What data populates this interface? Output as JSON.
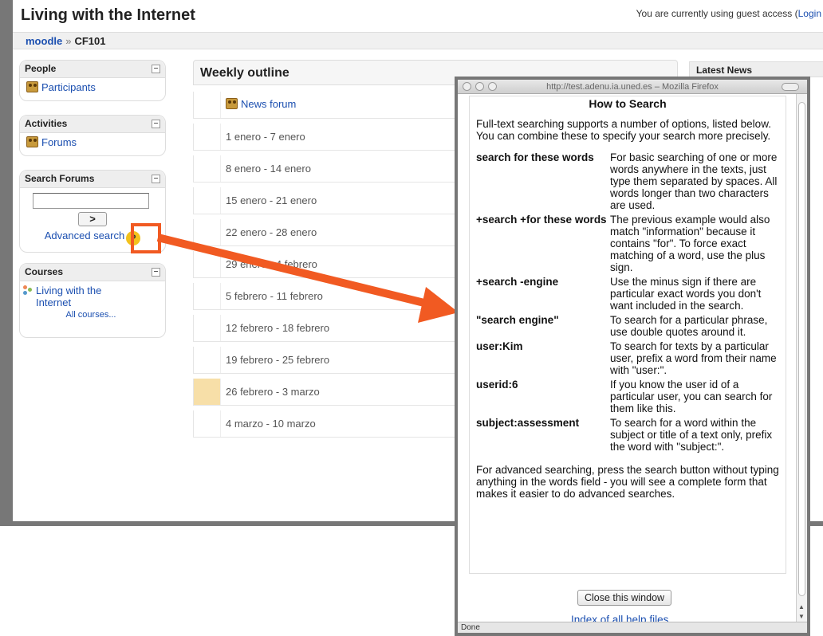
{
  "site": {
    "title": "Living with the Internet",
    "login_text": "You are currently using guest access (",
    "login_link": "Login"
  },
  "breadcrumb": {
    "home": "moodle",
    "sep": "»",
    "course": "CF101"
  },
  "blocks": {
    "people": {
      "title": "People",
      "toggle": "–",
      "item": "Participants"
    },
    "activities": {
      "title": "Activities",
      "toggle": "–",
      "item": "Forums"
    },
    "search": {
      "title": "Search Forums",
      "toggle": "–",
      "go": ">",
      "advanced": "Advanced search",
      "help": "?"
    },
    "courses": {
      "title": "Courses",
      "toggle": "–",
      "item": "Living with the Internet",
      "all": "All courses..."
    }
  },
  "outline": {
    "title": "Weekly outline",
    "news": "News forum",
    "weeks": [
      "1 enero - 7 enero",
      "8 enero - 14 enero",
      "15 enero - 21 enero",
      "22 enero - 28 enero",
      "29 enero - 4 febrero",
      "5 febrero - 11 febrero",
      "12 febrero - 18 febrero",
      "19 febrero - 25 febrero",
      "26 febrero - 3 marzo",
      "4 marzo - 10 marzo"
    ]
  },
  "right_block": {
    "title": "Latest News",
    "toggle": "–"
  },
  "popup": {
    "url": "http://test.adenu.ia.uned.es – Mozilla Firefox",
    "heading": "How to Search",
    "intro": "Full-text searching supports a number of options, listed below. You can combine these to specify your search more precisely.",
    "rows": [
      {
        "key": "search for these words",
        "desc": "For basic searching of one or more words anywhere in the texts, just type them separated by spaces. All words longer than two characters are used."
      },
      {
        "key": "+search +for these words",
        "desc": "The previous example would also match \"information\" because it contains \"for\". To force exact matching of a word, use the plus sign."
      },
      {
        "key": "+search -engine",
        "desc": "Use the minus sign if there are particular exact words you don't want included in the search."
      },
      {
        "key": "\"search engine\"",
        "desc": "To search for a particular phrase, use double quotes around it."
      },
      {
        "key": "user:Kim",
        "desc": "To search for texts by a particular user, prefix a word from their name with \"user:\"."
      },
      {
        "key": "userid:6",
        "desc": "If you know the user id of a particular user, you can search for them like this."
      },
      {
        "key": "subject:assessment",
        "desc": "To search for a word within the subject or title of a text only, prefix the word with \"subject:\"."
      }
    ],
    "outro": "For advanced searching, press the search button without typing anything in the words field - you will see a complete form that makes it easier to do advanced searches.",
    "close": "Close this window",
    "index": "Index of all help files",
    "status": "Done"
  },
  "colors": {
    "accent": "#f15a22",
    "link": "#1b4fb0",
    "current_week": "#f7dfa8"
  }
}
